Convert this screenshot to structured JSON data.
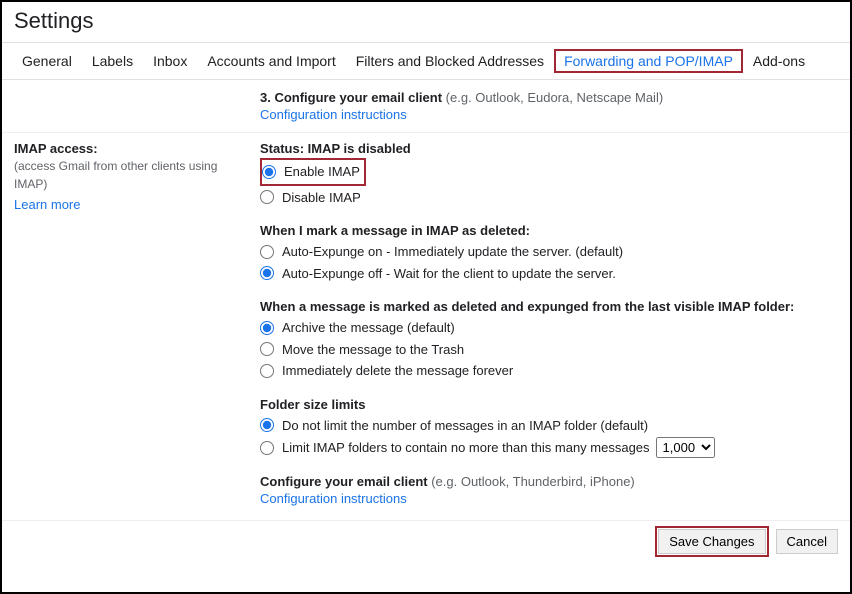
{
  "page_title": "Settings",
  "tabs": {
    "general": "General",
    "labels": "Labels",
    "inbox": "Inbox",
    "accounts": "Accounts and Import",
    "filters": "Filters and Blocked Addresses",
    "forwarding": "Forwarding and POP/IMAP",
    "addons": "Add-ons"
  },
  "top_section": {
    "step_bold": "3. Configure your email client",
    "step_hint": " (e.g. Outlook, Eudora, Netscape Mail)",
    "config_link": "Configuration instructions"
  },
  "imap": {
    "label": "IMAP access:",
    "hint": "(access Gmail from other clients using IMAP)",
    "learn_more": "Learn more",
    "status": "Status: IMAP is disabled",
    "enable": "Enable IMAP",
    "disable": "Disable IMAP",
    "deleted_title": "When I mark a message in IMAP as deleted:",
    "expunge_on": "Auto-Expunge on - Immediately update the server. (default)",
    "expunge_off": "Auto-Expunge off - Wait for the client to update the server.",
    "expunged_title": "When a message is marked as deleted and expunged from the last visible IMAP folder:",
    "archive": "Archive the message (default)",
    "trash": "Move the message to the Trash",
    "delete_forever": "Immediately delete the message forever",
    "folder_limits_title": "Folder size limits",
    "no_limit": "Do not limit the number of messages in an IMAP folder (default)",
    "limit_prefix": "Limit IMAP folders to contain no more than this many messages",
    "limit_value": "1,000",
    "configure_bold": "Configure your email client",
    "configure_hint": " (e.g. Outlook, Thunderbird, iPhone)",
    "configure_link": "Configuration instructions"
  },
  "footer": {
    "save": "Save Changes",
    "cancel": "Cancel"
  }
}
